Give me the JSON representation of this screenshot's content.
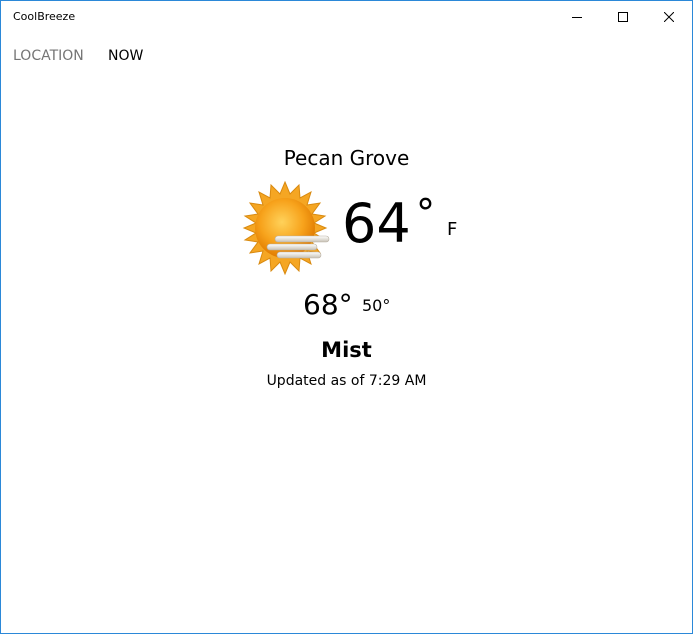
{
  "window": {
    "title": "CoolBreeze"
  },
  "nav": {
    "items": [
      {
        "label": "LOCATION"
      },
      {
        "label": "NOW"
      }
    ]
  },
  "weather": {
    "city": "Pecan Grove",
    "icon": "sun-with-fog-icon",
    "temperature": "64",
    "degree_symbol": "°",
    "unit": "F",
    "high": "68°",
    "low": "50°",
    "condition": "Mist",
    "updated": "Updated as of 7:29 AM"
  },
  "colors": {
    "window_border": "#2b88d8",
    "nav_inactive": "#757575",
    "sun": "#f7a21b"
  }
}
